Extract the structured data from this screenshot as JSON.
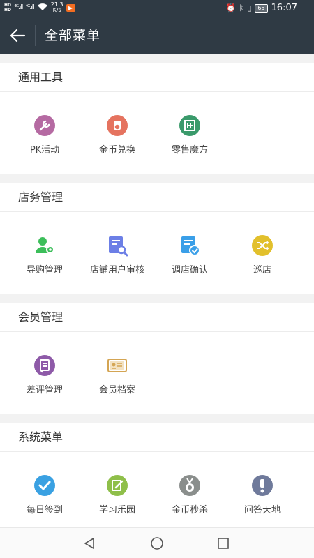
{
  "statusbar": {
    "hd1": "HD",
    "hd2": "HD",
    "sig1": "⁴ᴳ.ıll",
    "sig2": "⁴ᴳ.ıll",
    "speed_value": "21.3",
    "speed_unit": "K/s",
    "battery": "65",
    "time": "16:07"
  },
  "header": {
    "title": "全部菜单"
  },
  "sections": [
    {
      "title": "通用工具",
      "items": [
        {
          "label": "PK活动",
          "icon": "wrench-icon",
          "color": "#b56aa2"
        },
        {
          "label": "金币兑换",
          "icon": "coin-exchange-icon",
          "color": "#e5735f"
        },
        {
          "label": "零售魔方",
          "icon": "cube-icon",
          "color": "#3a9a6b"
        }
      ]
    },
    {
      "title": "店务管理",
      "items": [
        {
          "label": "导购管理",
          "icon": "user-gear-icon",
          "color": "#3cbe5a"
        },
        {
          "label": "店铺用户审核",
          "icon": "doc-search-icon",
          "color": "#6c7fe6"
        },
        {
          "label": "调店确认",
          "icon": "doc-check-icon",
          "color": "#3a9fe8"
        },
        {
          "label": "巡店",
          "icon": "shuffle-icon",
          "color": "#e2c02c"
        }
      ]
    },
    {
      "title": "会员管理",
      "items": [
        {
          "label": "差评管理",
          "icon": "note-icon",
          "color": "#8e5aa8"
        },
        {
          "label": "会员档案",
          "icon": "id-card-icon",
          "color": "#d4a553"
        }
      ]
    },
    {
      "title": "系统菜单",
      "items": [
        {
          "label": "每日签到",
          "icon": "check-circle-icon",
          "color": "#3aa1e2"
        },
        {
          "label": "学习乐园",
          "icon": "edit-icon",
          "color": "#8fbf4a"
        },
        {
          "label": "金币秒杀",
          "icon": "medal-icon",
          "color": "#8a8e8c"
        },
        {
          "label": "问答天地",
          "icon": "question-icon",
          "color": "#6f7a9b"
        }
      ]
    }
  ]
}
